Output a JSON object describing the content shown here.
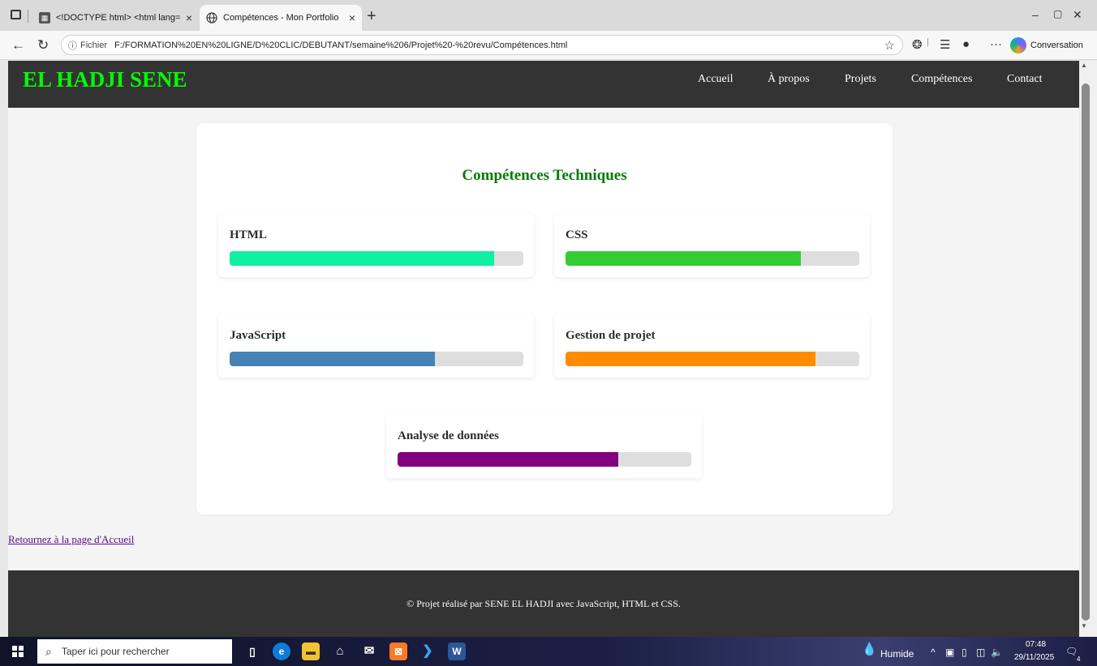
{
  "browser": {
    "tabs": [
      {
        "title": "<!DOCTYPE html> <html lang=\"f",
        "favicon": "code-icon"
      },
      {
        "title": "Compétences - Mon Portfolio",
        "favicon": "globe-icon"
      }
    ],
    "address": {
      "info_label": "Fichier",
      "url": "F:/FORMATION%20EN%20LIGNE/D%20CLIC/DEBUTANT/semaine%206/Projet%20-%20revu/Compétences.html"
    },
    "copilot_label": "Conversation"
  },
  "site": {
    "logo": "EL HADJI SENE",
    "nav": [
      "Accueil",
      "À propos",
      "Projets",
      "Compétences",
      "Contact"
    ]
  },
  "section_title": "Compétences Techniques",
  "skills": [
    {
      "name": "HTML",
      "level": 90,
      "color": "#0ff0a0"
    },
    {
      "name": "CSS",
      "level": 80,
      "color": "#33cc33"
    },
    {
      "name": "JavaScript",
      "level": 70,
      "color": "#4682b4"
    },
    {
      "name": "Gestion de projet",
      "level": 85,
      "color": "#ff8c00"
    },
    {
      "name": "Analyse de données",
      "level": 75,
      "color": "#800080"
    }
  ],
  "back_link": "Retournez à la page d'Accueil",
  "footer": "© Projet réalisé par SENE EL HADJI avec JavaScript, HTML et CSS.",
  "taskbar": {
    "search_placeholder": "Taper ici pour rechercher",
    "weather": "Humide",
    "time": "07:48",
    "date": "29/11/2025",
    "notifications": "4"
  }
}
